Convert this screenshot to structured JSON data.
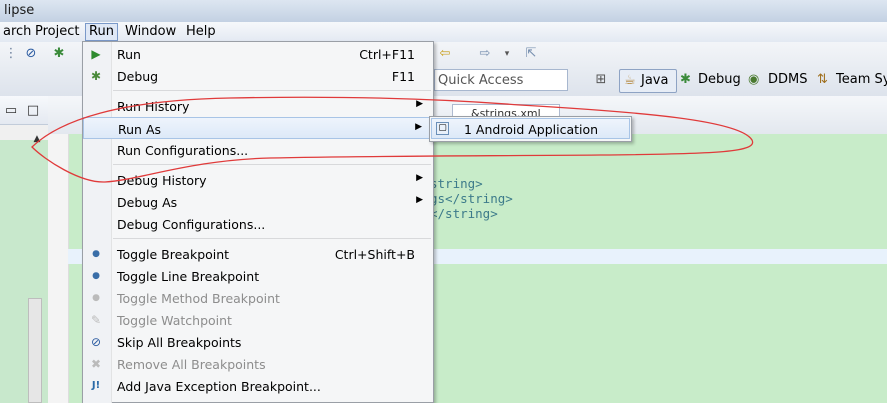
{
  "window": {
    "title": "lipse"
  },
  "menubar": {
    "items": [
      {
        "label": "arch"
      },
      {
        "label": "Project"
      },
      {
        "label": "Run"
      },
      {
        "label": "Window"
      },
      {
        "label": "Help"
      }
    ]
  },
  "toolbar": {
    "quick_access": {
      "placeholder": "Quick Access"
    },
    "perspectives": [
      {
        "label": "Java"
      },
      {
        "label": "Debug"
      },
      {
        "label": "DDMS"
      },
      {
        "label": "Team Sy"
      }
    ]
  },
  "editor": {
    "tab_label": "&strings.xml",
    "code_lines": [
      "string>",
      "gs</string>",
      "</string>"
    ]
  },
  "run_menu": {
    "items": [
      {
        "label": "Run",
        "shortcut": "Ctrl+F11",
        "icon": "run-icon"
      },
      {
        "label": "Debug",
        "shortcut": "F11",
        "icon": "debug-icon"
      },
      {
        "label": "Run History",
        "submenu": true
      },
      {
        "label": "Run As",
        "submenu": true,
        "highlighted": true
      },
      {
        "label": "Run Configurations..."
      },
      {
        "label": "Debug History",
        "submenu": true
      },
      {
        "label": "Debug As",
        "submenu": true
      },
      {
        "label": "Debug Configurations..."
      },
      {
        "label": "Toggle Breakpoint",
        "shortcut": "Ctrl+Shift+B",
        "icon": "breakpoint-icon"
      },
      {
        "label": "Toggle Line Breakpoint",
        "icon": "line-breakpoint-icon"
      },
      {
        "label": "Toggle Method Breakpoint",
        "disabled": true,
        "icon": "method-breakpoint-icon"
      },
      {
        "label": "Toggle Watchpoint",
        "disabled": true,
        "icon": "watchpoint-icon"
      },
      {
        "label": "Skip All Breakpoints",
        "icon": "skip-breakpoints-icon"
      },
      {
        "label": "Remove All Breakpoints",
        "disabled": true,
        "icon": "remove-breakpoints-icon"
      },
      {
        "label": "Add Java Exception Breakpoint...",
        "icon": "exception-breakpoint-icon"
      }
    ]
  },
  "run_as_submenu": {
    "items": [
      {
        "label": "1 Android Application",
        "icon": "android-app-icon"
      }
    ]
  },
  "annotation": {
    "color": "#e03a3a"
  },
  "colors": {
    "editor_bg": "#c8ecc9",
    "menu_hover": "#dde9f8"
  }
}
